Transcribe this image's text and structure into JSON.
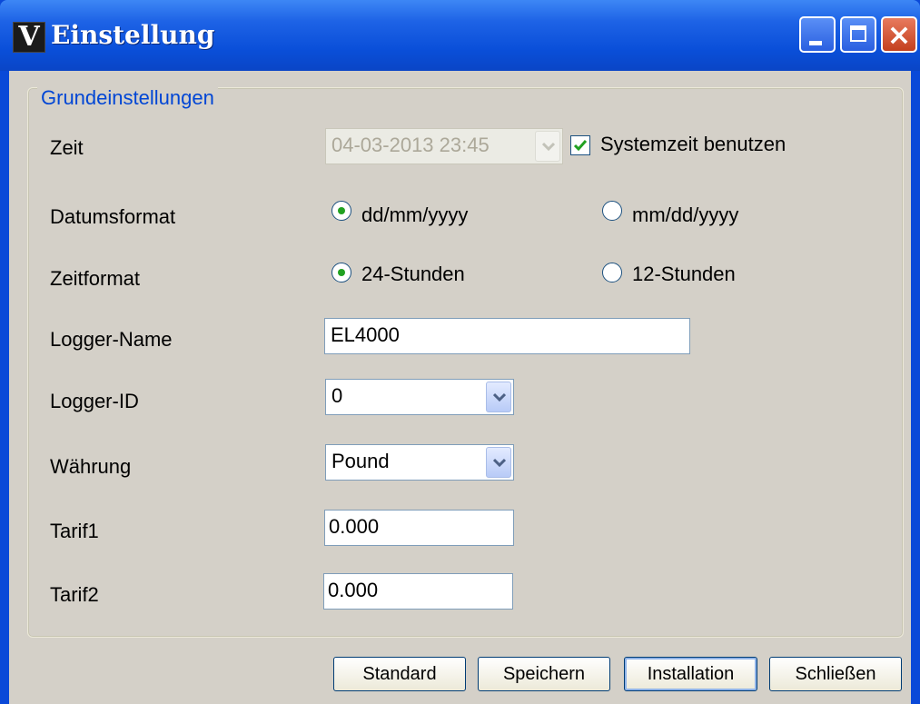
{
  "window": {
    "title": "Einstellung",
    "app_icon": "V"
  },
  "group": {
    "legend": "Grundeinstellungen"
  },
  "fields": {
    "zeit": {
      "label": "Zeit",
      "value": "04-03-2013 23:45",
      "checkbox_label": "Systemzeit benutzen",
      "checked": true
    },
    "datumsformat": {
      "label": "Datumsformat",
      "option1": "dd/mm/yyyy",
      "option2": "mm/dd/yyyy",
      "selected": "dd/mm/yyyy"
    },
    "zeitformat": {
      "label": "Zeitformat",
      "option1": "24-Stunden",
      "option2": "12-Stunden",
      "selected": "24-Stunden"
    },
    "logger_name": {
      "label": "Logger-Name",
      "value": "EL4000"
    },
    "logger_id": {
      "label": "Logger-ID",
      "value": "0"
    },
    "waehrung": {
      "label": "Währung",
      "value": "Pound"
    },
    "tarif1": {
      "label": "Tarif1",
      "value": "0.000"
    },
    "tarif2": {
      "label": "Tarif2",
      "value": "0.000"
    }
  },
  "buttons": {
    "standard": "Standard",
    "speichern": "Speichern",
    "installation": "Installation",
    "schliessen": "Schließen"
  },
  "colors": {
    "titlebar": "#0a4fd9",
    "client": "#d4d0c8",
    "legend": "#0046d5",
    "check": "#21a121"
  }
}
